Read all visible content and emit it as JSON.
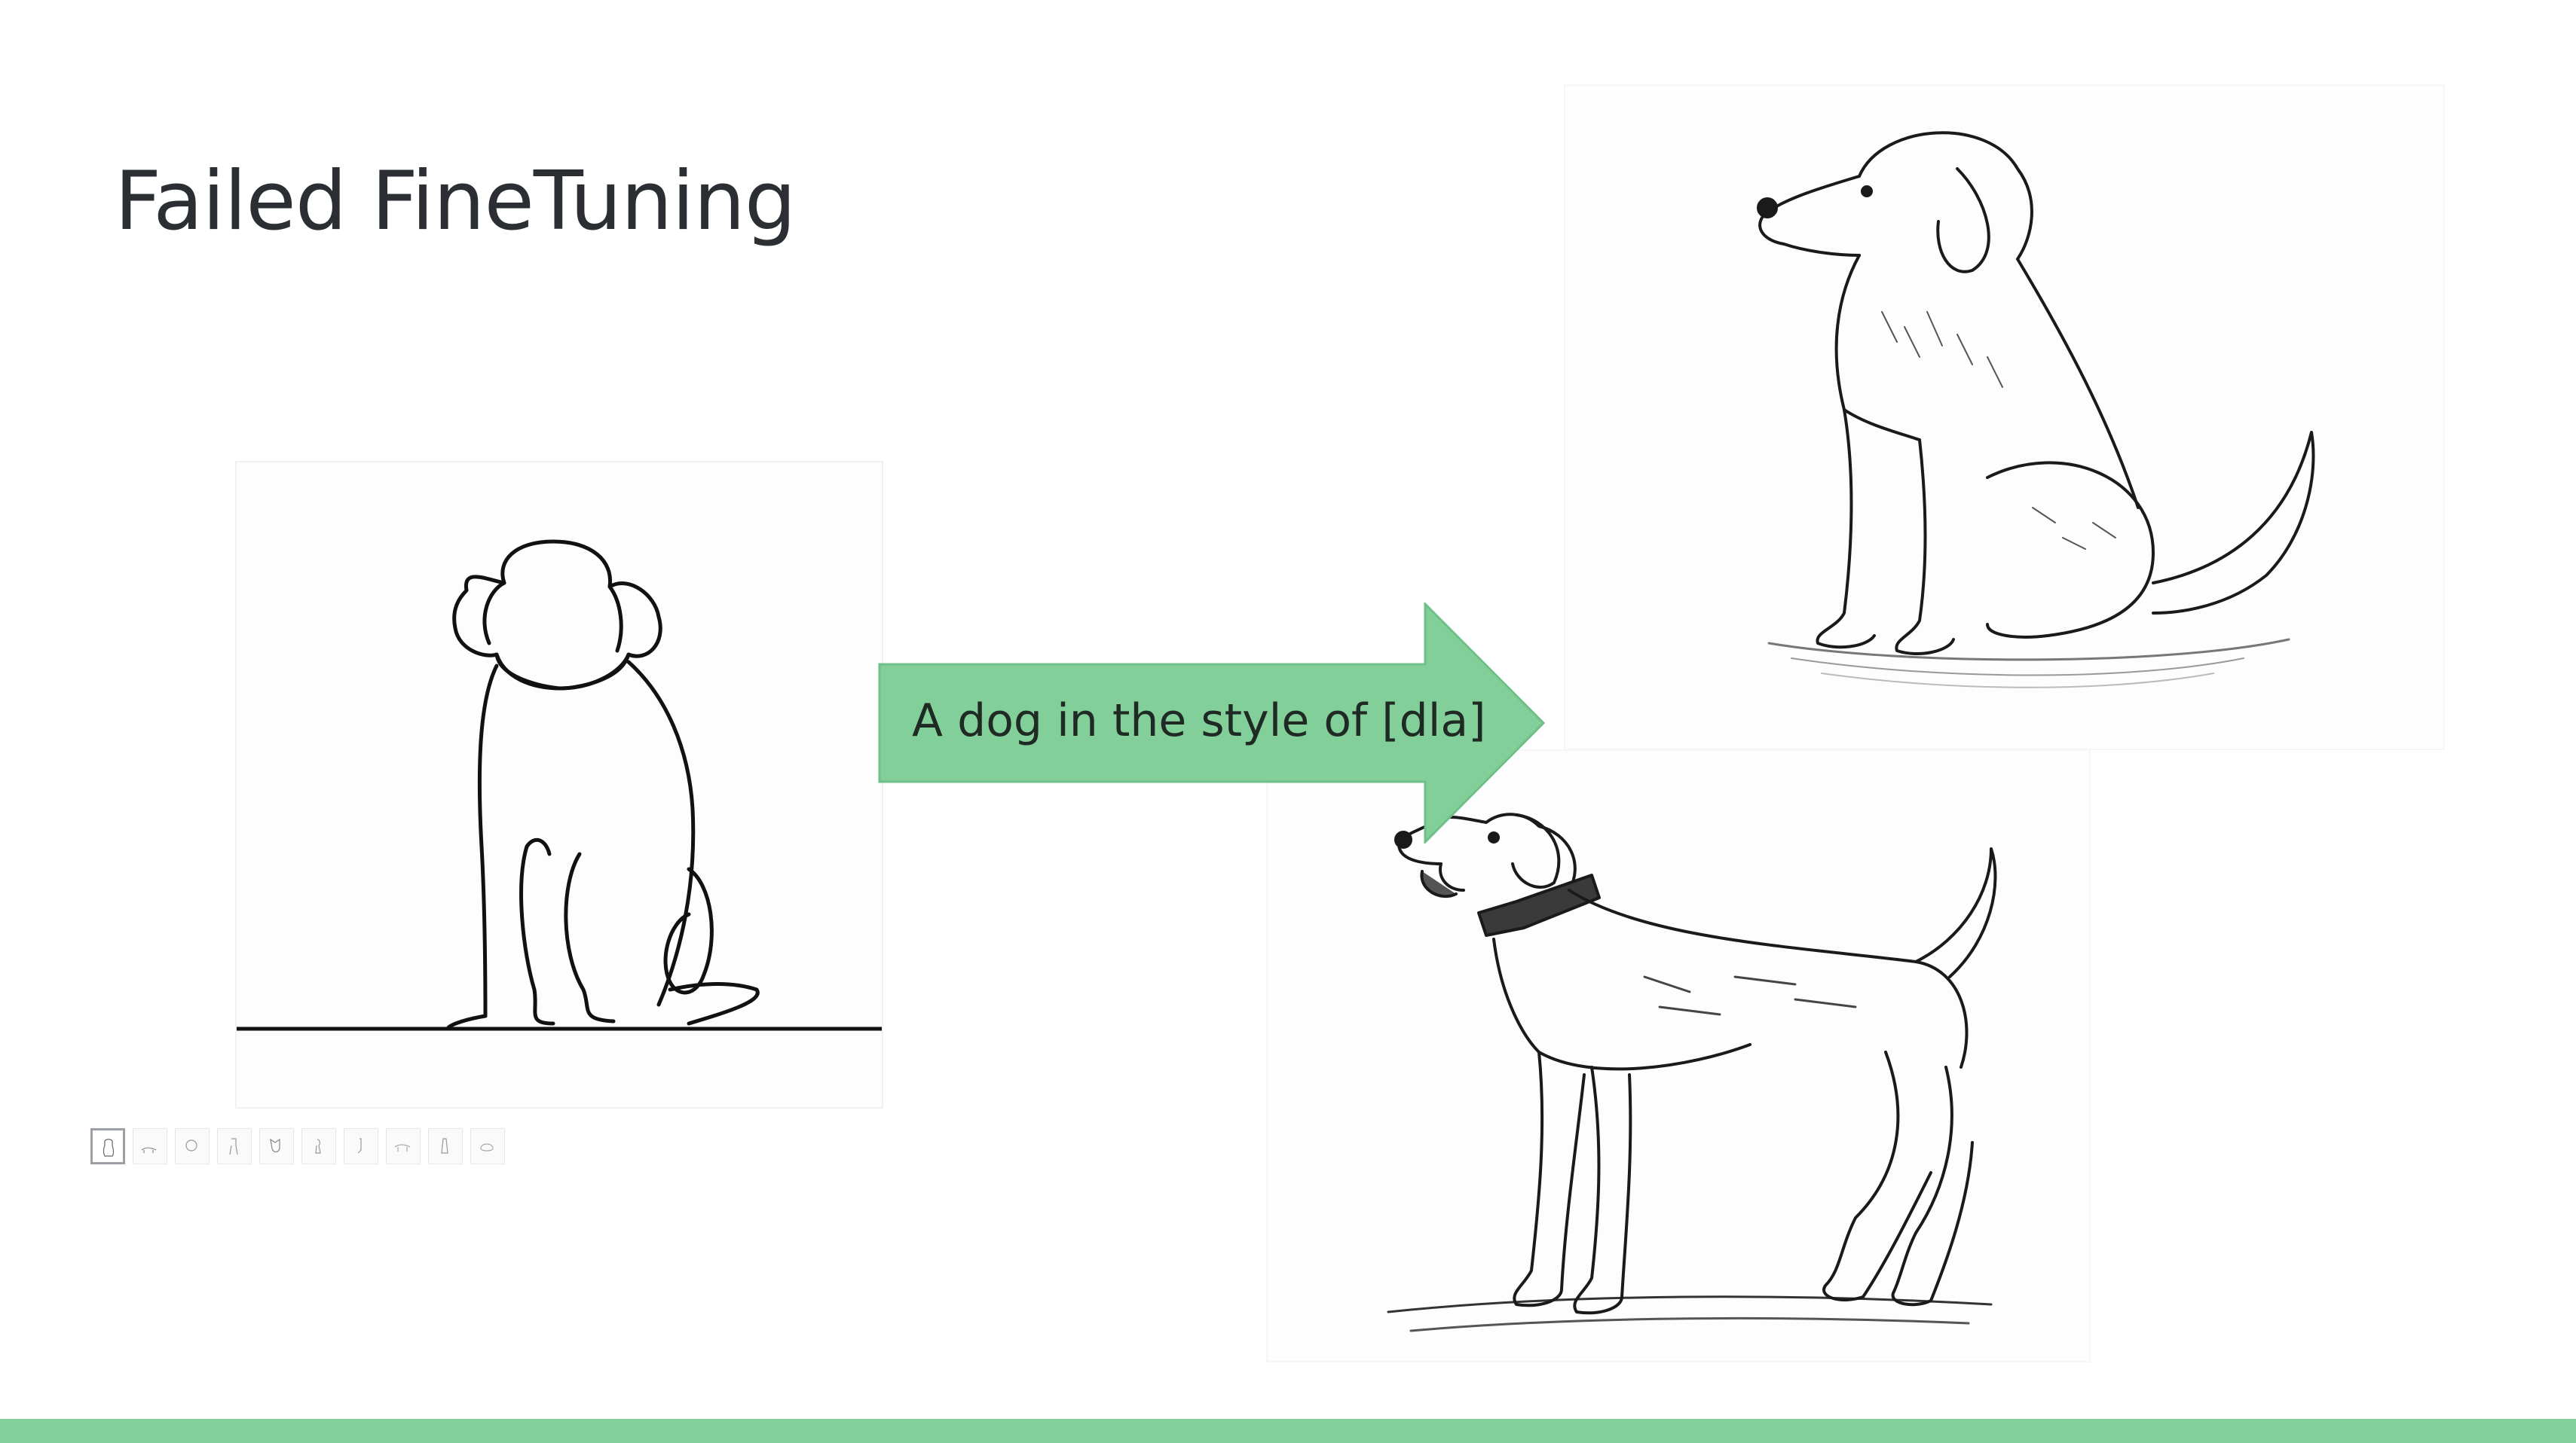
{
  "slide": {
    "title": "Failed FineTuning",
    "arrow_caption": "A dog in the style of [dla]"
  },
  "thumbnails": {
    "count": 10,
    "active_index": 0
  },
  "colors": {
    "accent": "#82cf9a",
    "arrow_border": "#6fbf88",
    "title": "#2b2e33",
    "ink": "#111111"
  },
  "images": [
    {
      "name": "line-art-dog",
      "role": "training style example"
    },
    {
      "name": "sitting-dog-sketch",
      "role": "generated output"
    },
    {
      "name": "standing-dog-sketch",
      "role": "generated output"
    }
  ]
}
